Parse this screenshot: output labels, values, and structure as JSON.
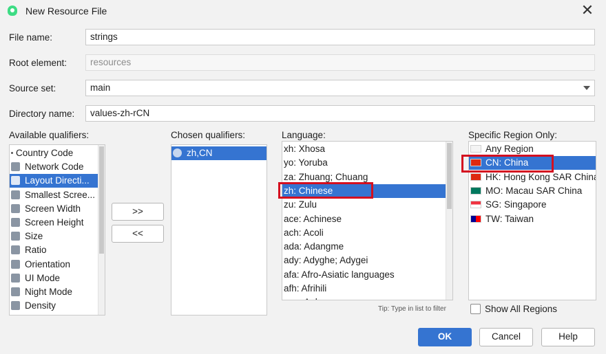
{
  "window": {
    "title": "New Resource File",
    "close_glyph": "✕"
  },
  "form": {
    "file_name_label": "File name:",
    "file_name_value": "strings",
    "root_element_label": "Root element:",
    "root_element_value": "resources",
    "source_set_label": "Source set:",
    "source_set_value": "main",
    "directory_name_label": "Directory name:",
    "directory_name_value": "values-zh-rCN"
  },
  "available_qualifiers": {
    "label": "Available qualifiers:",
    "selected_index": 2,
    "items": [
      {
        "label": "Country Code",
        "icon": "dot-icon"
      },
      {
        "label": "Network Code",
        "icon": "network-icon"
      },
      {
        "label": "Layout Directi...",
        "icon": "layout-direction-icon"
      },
      {
        "label": "Smallest Scree...",
        "icon": "smallest-screen-icon"
      },
      {
        "label": "Screen Width",
        "icon": "screen-width-icon"
      },
      {
        "label": "Screen Height",
        "icon": "screen-height-icon"
      },
      {
        "label": "Size",
        "icon": "size-icon"
      },
      {
        "label": "Ratio",
        "icon": "ratio-icon"
      },
      {
        "label": "Orientation",
        "icon": "orientation-icon"
      },
      {
        "label": "UI Mode",
        "icon": "ui-mode-icon"
      },
      {
        "label": "Night Mode",
        "icon": "night-mode-icon"
      },
      {
        "label": "Density",
        "icon": "density-icon"
      }
    ]
  },
  "transfer_buttons": {
    "add": ">>",
    "remove": "<<"
  },
  "chosen_qualifiers": {
    "label": "Chosen qualifiers:",
    "items": [
      {
        "label": "zh,CN",
        "icon": "globe-icon"
      }
    ]
  },
  "language": {
    "label": "Language:",
    "selected_index": 3,
    "items": [
      "xh: Xhosa",
      "yo: Yoruba",
      "za: Zhuang; Chuang",
      "zh: Chinese",
      "zu: Zulu",
      "ace: Achinese",
      "ach: Acoli",
      "ada: Adangme",
      "ady: Adyghe; Adygei",
      "afa: Afro-Asiatic languages",
      "afh: Afrihili",
      "agq: Aghem"
    ],
    "tip": "Tip: Type in list to filter"
  },
  "region": {
    "label": "Specific Region Only:",
    "selected_index": 1,
    "items": [
      {
        "label": "Any Region",
        "flag": "blank-flag-icon"
      },
      {
        "label": "CN: China",
        "flag": "china-flag-icon"
      },
      {
        "label": "HK: Hong Kong SAR China",
        "flag": "hong-kong-flag-icon"
      },
      {
        "label": "MO: Macau SAR China",
        "flag": "macau-flag-icon"
      },
      {
        "label": "SG: Singapore",
        "flag": "singapore-flag-icon"
      },
      {
        "label": "TW: Taiwan",
        "flag": "taiwan-flag-icon"
      }
    ],
    "show_all_label": "Show All Regions",
    "show_all_checked": false
  },
  "footer": {
    "ok": "OK",
    "cancel": "Cancel",
    "help": "Help"
  },
  "colors": {
    "selection": "#3574d1",
    "highlight_box": "#d40f1f",
    "primary_button": "#3574d1"
  }
}
